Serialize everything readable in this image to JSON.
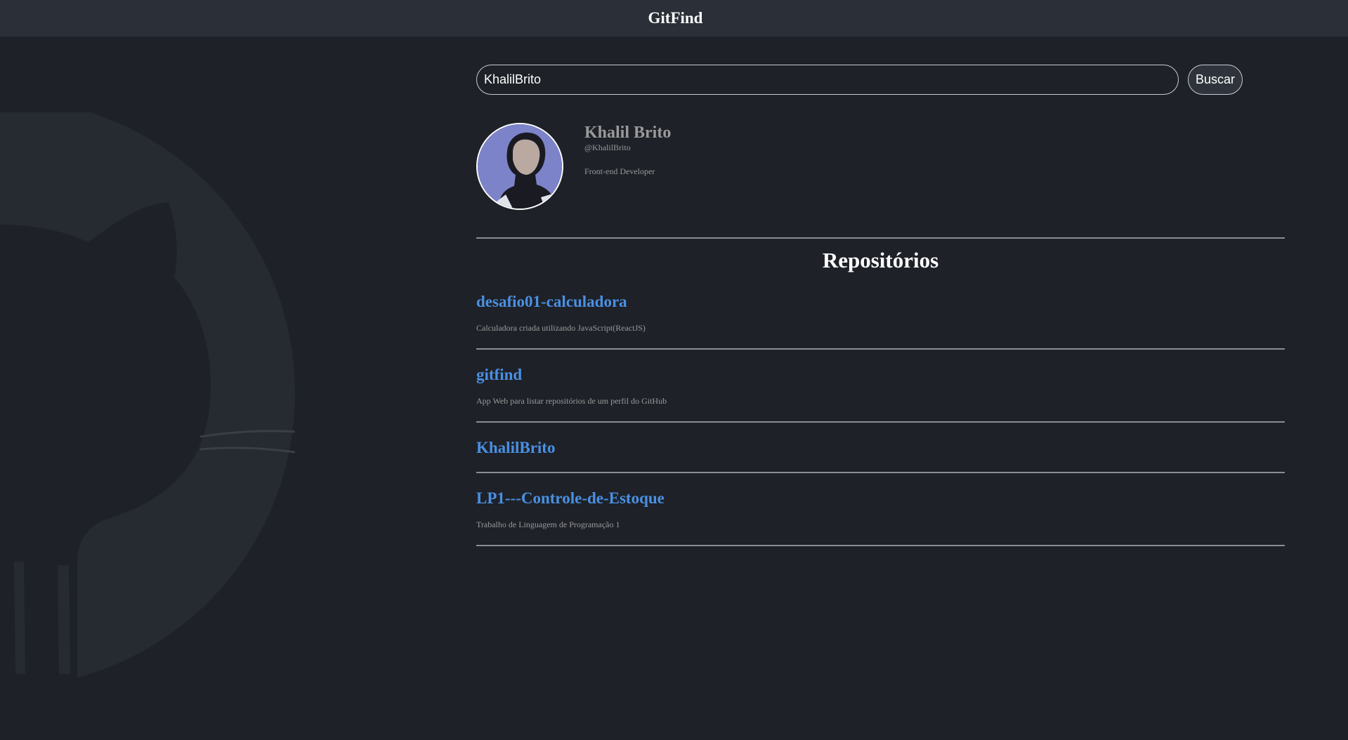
{
  "header": {
    "title": "GitFind"
  },
  "search": {
    "value": "KhalilBrito",
    "button_label": "Buscar"
  },
  "profile": {
    "name": "Khalil Brito",
    "login": "@KhalilBrito",
    "bio": "Front-end Developer"
  },
  "repos": {
    "title": "Repositórios",
    "items": [
      {
        "name": "desafio01-calculadora",
        "description": "Calculadora criada utilizando JavaScript(ReactJS)"
      },
      {
        "name": "gitfind",
        "description": "App Web para listar repositórios de um perfil do GitHub"
      },
      {
        "name": "KhalilBrito",
        "description": ""
      },
      {
        "name": "LP1---Controle-de-Estoque",
        "description": "Trabalho de Linguagem de Programação 1"
      }
    ]
  },
  "colors": {
    "background": "#1e2128",
    "header": "#2b3038",
    "repo_link": "#4a90e2",
    "muted_text": "#9a9a9a"
  },
  "icons": {
    "background": "github-octocat-icon",
    "avatar": "user-avatar"
  }
}
